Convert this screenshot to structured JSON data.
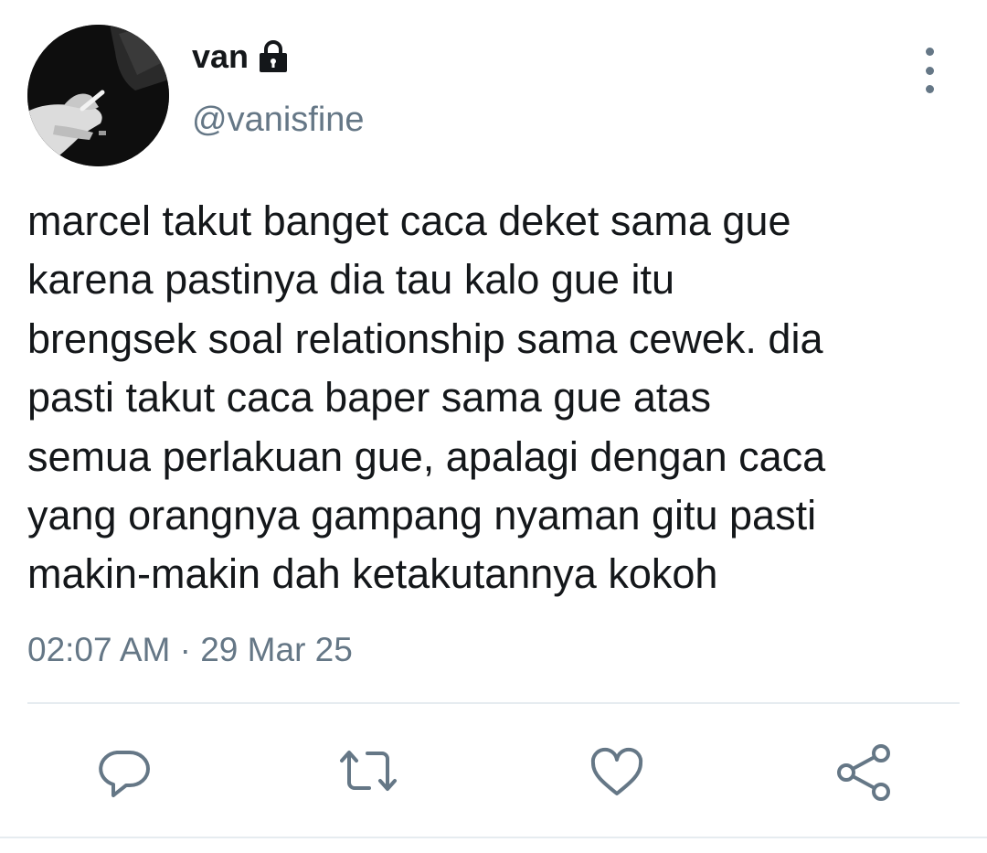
{
  "tweet": {
    "display_name": "van",
    "handle": "@vanisfine",
    "text": "marcel takut banget caca deket sama gue\nkarena pastinya dia tau kalo gue itu\nbrengsek soal relationship sama cewek. dia\npasti takut caca baper sama gue atas\nsemua perlakuan gue, apalagi dengan caca\nyang orangnya gampang nyaman gitu pasti\nmakin-makin dah ketakutannya kokoh",
    "time": "02:07 AM",
    "separator": "·",
    "date": "29 Mar 25",
    "protected": true
  },
  "icons": {
    "lock": "lock-icon",
    "more": "more-vertical-icon",
    "reply": "reply-icon",
    "retweet": "retweet-icon",
    "like": "heart-icon",
    "share": "share-icon"
  },
  "colors": {
    "text": "#14171a",
    "secondary": "#657786",
    "divider": "#e6ecf0"
  }
}
